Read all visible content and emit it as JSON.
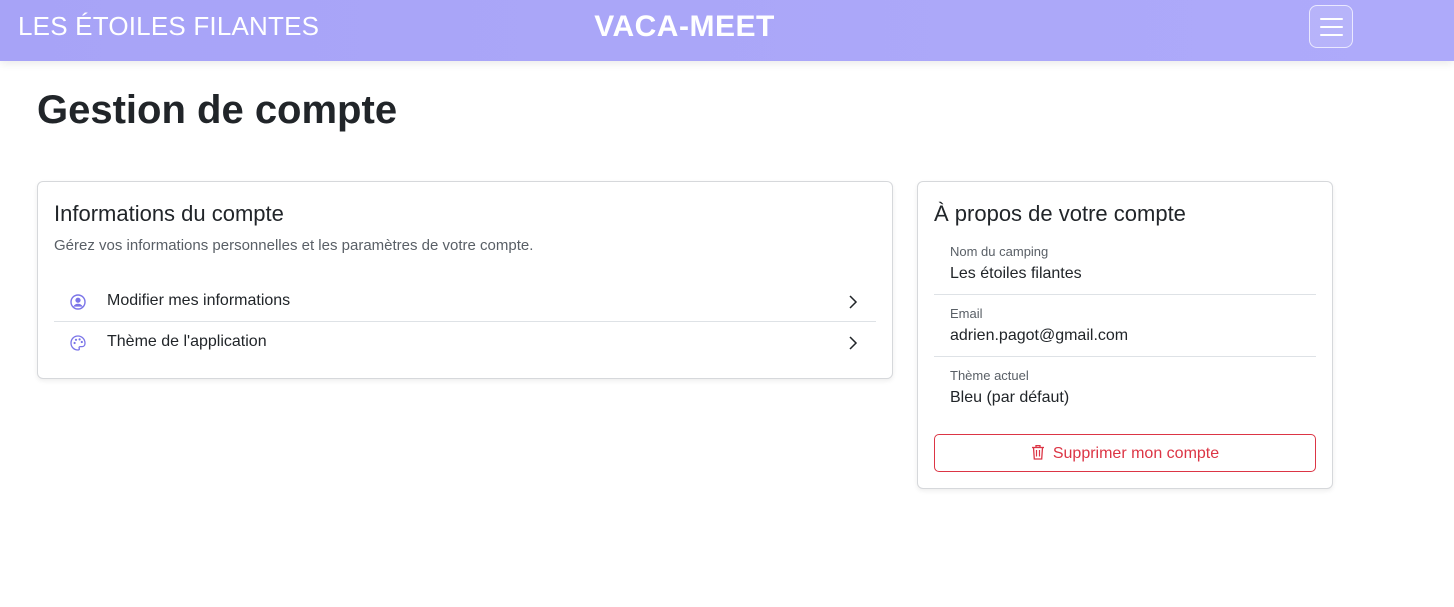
{
  "header": {
    "brand_left": "LES ÉTOILES FILANTES",
    "brand_center": "VACA-MEET",
    "menu_icon": "hamburger-icon",
    "accent_color": "#a9a5f8"
  },
  "page": {
    "title": "Gestion de compte"
  },
  "account_info": {
    "title": "Informations du compte",
    "description": "Gérez vos informations personnelles et les paramètres de votre compte.",
    "items": [
      {
        "label": "Modifier mes informations",
        "icon": "user-circle-icon"
      },
      {
        "label": "Thème de l'application",
        "icon": "palette-icon"
      }
    ]
  },
  "about": {
    "title": "À propos de votre compte",
    "fields": [
      {
        "label": "Nom du camping",
        "value": "Les étoiles filantes"
      },
      {
        "label": "Email",
        "value": "adrien.pagot@gmail.com"
      },
      {
        "label": "Thème actuel",
        "value": "Bleu (par défaut)"
      }
    ],
    "delete_label": "Supprimer mon compte",
    "delete_icon": "trash-icon",
    "danger_color": "#dc3545"
  }
}
